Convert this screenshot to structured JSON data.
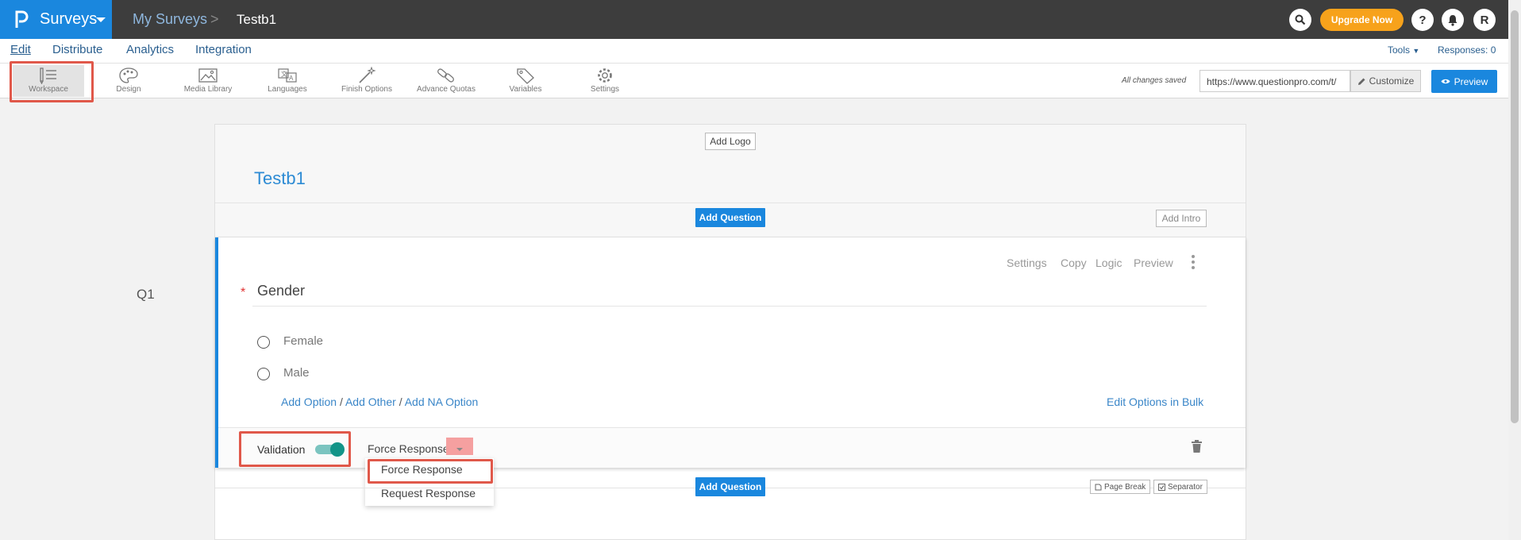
{
  "app": {
    "brand": "Surveys",
    "breadcrumb": [
      "My Surveys",
      "Testb1"
    ],
    "breadcrumb_separator": ">",
    "upgrade_label": "Upgrade Now",
    "help_label": "?",
    "avatar_initial": "R"
  },
  "nav": {
    "links": [
      "Edit",
      "Distribute",
      "Analytics",
      "Integration"
    ],
    "tools_label": "Tools",
    "responses_label": "Responses: 0"
  },
  "toolbar": {
    "items": [
      "Workspace",
      "Design",
      "Media Library",
      "Languages",
      "Finish Options",
      "Advance Quotas",
      "Variables",
      "Settings"
    ],
    "saved_text": "All changes saved",
    "survey_url": "https://www.questionpro.com/t/",
    "customize_label": "Customize",
    "preview_label": "Preview"
  },
  "survey": {
    "add_logo_label": "Add Logo",
    "title": "Testb1",
    "add_question_label": "Add Question",
    "add_intro_label": "Add Intro",
    "page_break_label": "Page Break",
    "separator_label": "Separator"
  },
  "question": {
    "number": "Q1",
    "required_mark": "*",
    "text": "Gender",
    "actions": [
      "Settings",
      "Copy",
      "Logic",
      "Preview"
    ],
    "options": [
      "Female",
      "Male"
    ],
    "add_links": [
      "Add Option",
      "Add Other",
      "Add NA Option"
    ],
    "link_separator": "/",
    "bulk_edit_label": "Edit Options in Bulk",
    "validation_label": "Validation",
    "validation_enabled": true,
    "validation_value": "Force Response",
    "validation_menu": [
      "Force Response",
      "Request Response"
    ]
  },
  "colors": {
    "brand_blue": "#1a87de",
    "top_bar": "#3d3d3d",
    "upgrade_orange": "#f7a21b",
    "highlight_red": "#e0584a",
    "toggle_teal": "#139488"
  }
}
